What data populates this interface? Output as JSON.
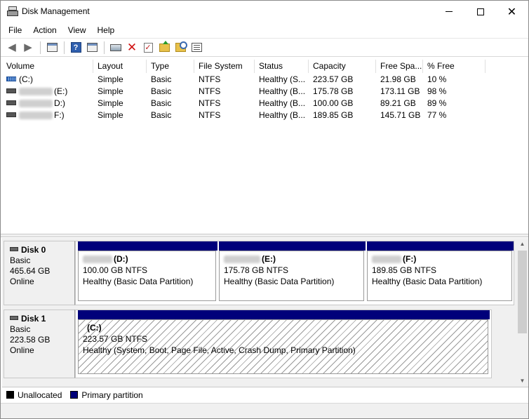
{
  "window": {
    "title": "Disk Management"
  },
  "menu": [
    "File",
    "Action",
    "View",
    "Help"
  ],
  "toolbar": [
    "back-icon",
    "forward-icon",
    "properties-icon",
    "help-icon",
    "console-icon",
    "connect-icon",
    "delete-icon",
    "check-icon",
    "folder-up-icon",
    "search-icon",
    "list-icon"
  ],
  "volumes": {
    "headers": [
      "Volume",
      "Layout",
      "Type",
      "File System",
      "Status",
      "Capacity",
      "Free Spa...",
      "% Free"
    ],
    "rows": [
      {
        "volume": "(C:)",
        "layout": "Simple",
        "type": "Basic",
        "fs": "NTFS",
        "status": "Healthy (S...",
        "capacity": "223.57 GB",
        "free": "21.98 GB",
        "pct": "10 %"
      },
      {
        "volume": "(E:)",
        "layout": "Simple",
        "type": "Basic",
        "fs": "NTFS",
        "status": "Healthy (B...",
        "capacity": "175.78 GB",
        "free": "173.11 GB",
        "pct": "98 %"
      },
      {
        "volume": "D:)",
        "layout": "Simple",
        "type": "Basic",
        "fs": "NTFS",
        "status": "Healthy (B...",
        "capacity": "100.00 GB",
        "free": "89.21 GB",
        "pct": "89 %"
      },
      {
        "volume": "F:)",
        "layout": "Simple",
        "type": "Basic",
        "fs": "NTFS",
        "status": "Healthy (B...",
        "capacity": "189.85 GB",
        "free": "145.71 GB",
        "pct": "77 %"
      }
    ]
  },
  "disks": [
    {
      "name": "Disk 0",
      "type": "Basic",
      "size": "465.64 GB",
      "state": "Online",
      "partitions": [
        {
          "label": "(D:)",
          "size": "100.00 GB NTFS",
          "status": "Healthy (Basic Data Partition)"
        },
        {
          "label": "(E:)",
          "size": "175.78 GB NTFS",
          "status": "Healthy (Basic Data Partition)"
        },
        {
          "label": "(F:)",
          "size": "189.85 GB NTFS",
          "status": "Healthy (Basic Data Partition)"
        }
      ]
    },
    {
      "name": "Disk 1",
      "type": "Basic",
      "size": "223.58 GB",
      "state": "Online",
      "partitions": [
        {
          "label": "(C:)",
          "size": "223.57 GB NTFS",
          "status": "Healthy (System, Boot, Page File, Active, Crash Dump, Primary Partition)"
        }
      ]
    }
  ],
  "legend": [
    {
      "label": "Unallocated",
      "color": "#000000"
    },
    {
      "label": "Primary partition",
      "color": "#00007a"
    }
  ]
}
